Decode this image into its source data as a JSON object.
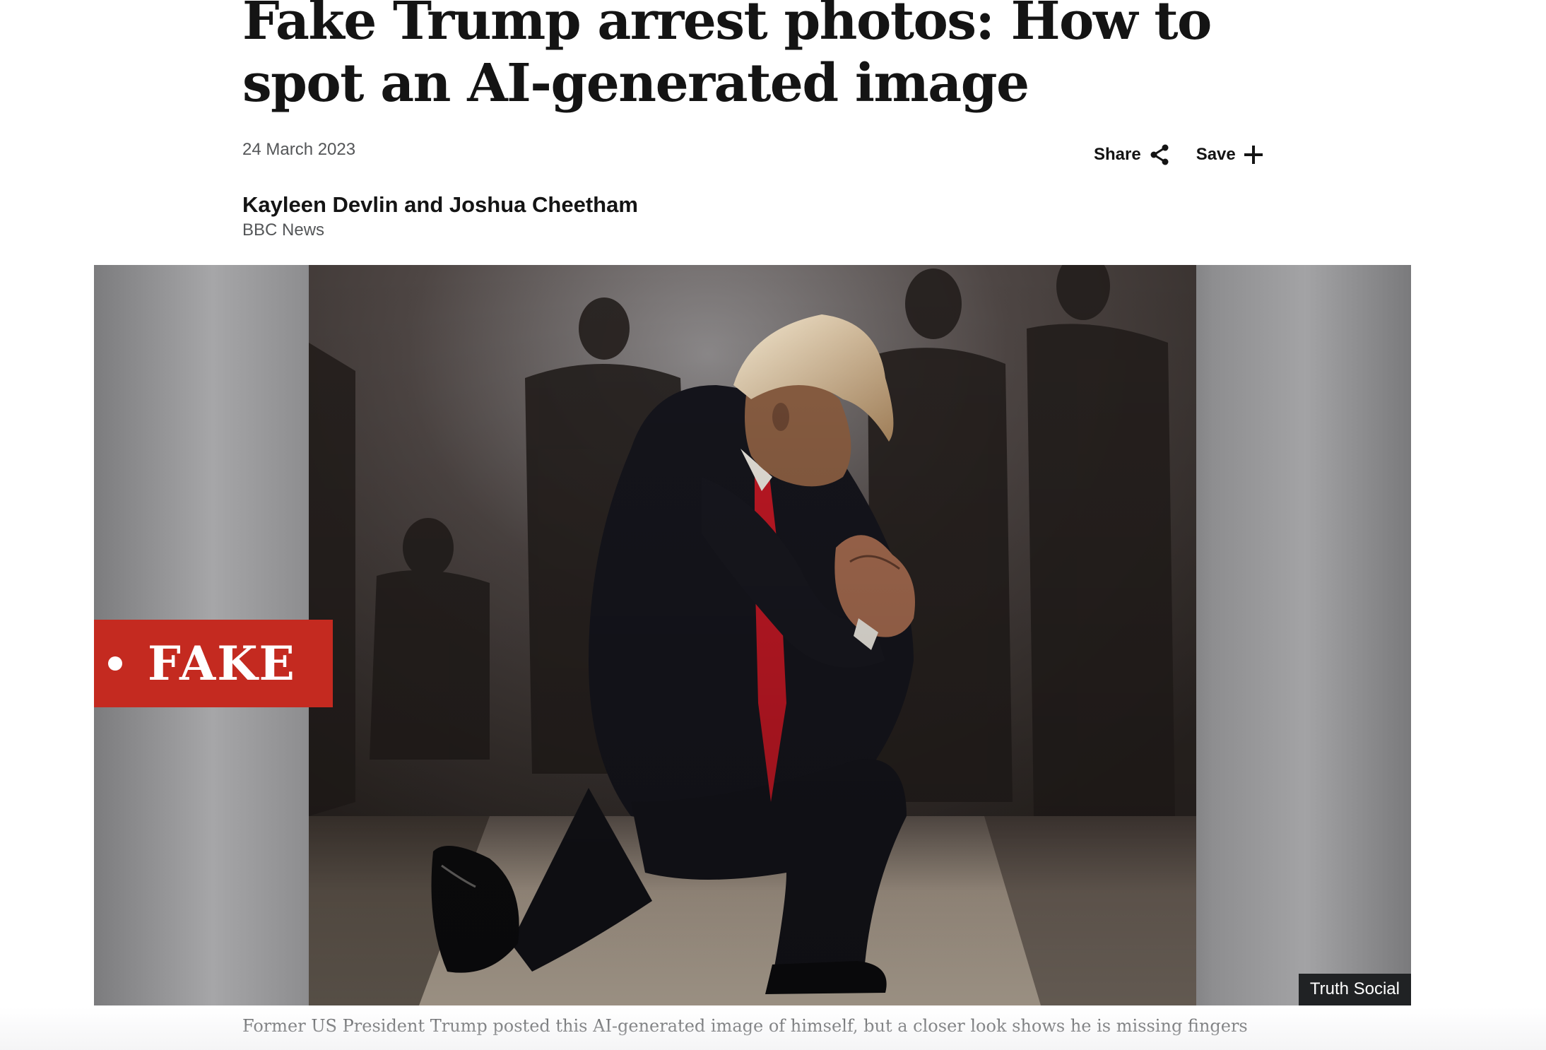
{
  "article": {
    "headline": "Fake Trump arrest photos: How to spot an AI-generated image",
    "date": "24 March 2023",
    "author": "Kayleen Devlin and Joshua Cheetham",
    "outlet": "BBC News"
  },
  "actions": {
    "share_label": "Share",
    "save_label": "Save",
    "share_icon": "share-icon",
    "save_icon": "plus-icon"
  },
  "image": {
    "badge_label": "FAKE",
    "badge_color": "#c42a20",
    "credit": "Truth Social",
    "caption": "Former US President Trump posted this AI-generated image of himself, but a closer look shows he is missing fingers"
  }
}
